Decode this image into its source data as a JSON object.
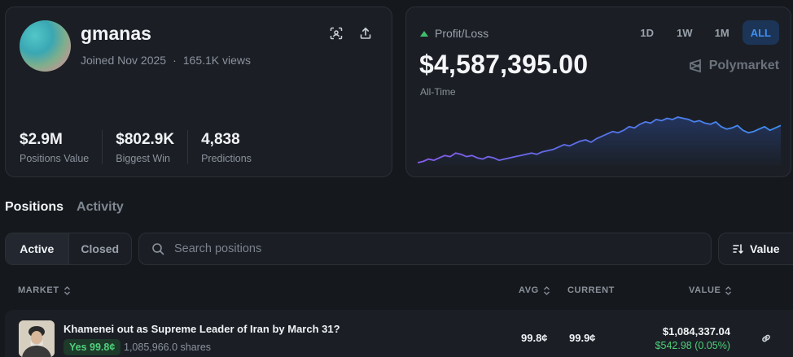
{
  "profile": {
    "username": "gmanas",
    "joined": "Joined Nov 2025",
    "views": "165.1K views",
    "stats": [
      {
        "value": "$2.9M",
        "label": "Positions Value"
      },
      {
        "value": "$802.9K",
        "label": "Biggest Win"
      },
      {
        "value": "4,838",
        "label": "Predictions"
      }
    ]
  },
  "pnl": {
    "label": "Profit/Loss",
    "value": "$4,587,395.00",
    "period_label": "All-Time",
    "ranges": [
      "1D",
      "1W",
      "1M",
      "ALL"
    ],
    "active_range": "ALL",
    "brand": "Polymarket",
    "colors": {
      "positive": "#3fbf6e",
      "accent": "#3f8ef0"
    }
  },
  "chart_data": {
    "type": "area",
    "values": [
      8,
      9,
      11,
      10,
      12,
      14,
      13,
      16,
      15,
      13,
      14,
      12,
      11,
      13,
      12,
      10,
      11,
      12,
      13,
      14,
      15,
      16,
      15,
      17,
      18,
      19,
      21,
      23,
      22,
      24,
      26,
      27,
      25,
      28,
      30,
      32,
      34,
      33,
      35,
      38,
      37,
      40,
      42,
      41,
      44,
      43,
      45,
      44,
      46,
      45,
      44,
      42,
      43,
      41,
      40,
      42,
      38,
      36,
      37,
      39,
      35,
      33,
      34,
      36,
      38,
      35,
      37,
      39
    ],
    "title": "",
    "xlabel": "",
    "ylabel": ""
  },
  "tabs": {
    "items": [
      "Positions",
      "Activity"
    ],
    "active": "Positions"
  },
  "filter": {
    "options": [
      "Active",
      "Closed"
    ],
    "active": "Active"
  },
  "search": {
    "placeholder": "Search positions"
  },
  "sort": {
    "label": "Value"
  },
  "table": {
    "headers": {
      "market": "MARKET",
      "avg": "AVG",
      "current": "CURRENT",
      "value": "VALUE"
    },
    "rows": [
      {
        "title": "Khamenei out as Supreme Leader of Iran by March 31?",
        "outcome": "Yes 99.8¢",
        "shares": "1,085,966.0 shares",
        "avg": "99.8¢",
        "current": "99.9¢",
        "value": "$1,084,337.04",
        "pnl": "$542.98 (0.05%)"
      }
    ]
  }
}
